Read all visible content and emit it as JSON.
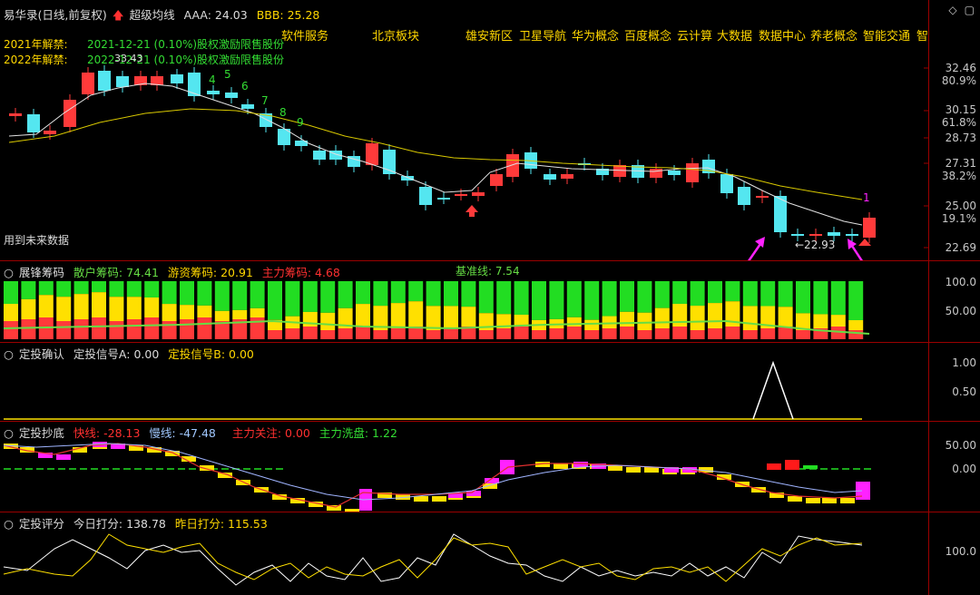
{
  "main": {
    "stock_name": "易华录(日线,前复权)",
    "indicator_name": "超级均线",
    "aaa": "AAA: 24.03",
    "bbb": "BBB: 25.28",
    "concepts": [
      "软件服务",
      "北京板块",
      "雄安新区",
      "卫星导航",
      "华为概念",
      "百度概念",
      "云计算",
      "大数据",
      "数据中心",
      "养老概念",
      "智能交通",
      "智"
    ],
    "unlock_2021_label": "2021年解禁:",
    "unlock_2021_text": "2021-12-21 (0.10%)股权激励限售股份",
    "unlock_2022_label": "2022年解禁:",
    "unlock_2022_text": "2022-12-21 (0.10%)股权激励限售股份",
    "high_label": "33.43",
    "low_label": "22.93",
    "future_label": "用到未来数据",
    "marker_1": "1",
    "count_labels": [
      "4",
      "5",
      "6",
      "7",
      "8",
      "9"
    ],
    "axis": [
      "32.46",
      "80.9%",
      "30.15",
      "61.8%",
      "28.73",
      "27.31",
      "38.2%",
      "25.00",
      "19.1%",
      "22.69"
    ]
  },
  "chips": {
    "title": "展锋筹码",
    "retail": "散户筹码: 74.41",
    "hot": "游资筹码: 20.91",
    "main": "主力筹码: 4.68",
    "base": "基准线: 7.54",
    "axis": [
      "100.0",
      "50.00"
    ]
  },
  "confirm": {
    "title": "定投确认",
    "sig_a": "定投信号A: 0.00",
    "sig_b": "定投信号B: 0.00",
    "axis": [
      "1.00",
      "0.50"
    ]
  },
  "bottom": {
    "title": "定投抄底",
    "fast": "快线: -28.13",
    "slow": "慢线: -47.48",
    "focus": "主力关注: 0.00",
    "wash": "主力洗盘: 1.22",
    "axis": [
      "50.00",
      "0.00"
    ]
  },
  "score": {
    "title": "定投评分",
    "today": "今日打分: 138.78",
    "yesterday": "昨日打分: 115.53",
    "axis": [
      "100.0"
    ]
  },
  "colors": {
    "up": "#ff3a3a",
    "down": "#54e6f0",
    "ma_fast": "#e0e0e0",
    "ma_slow": "#d8c800",
    "magenta": "#ff22ff",
    "yellow": "#ffe000",
    "green": "#22dd22"
  }
}
